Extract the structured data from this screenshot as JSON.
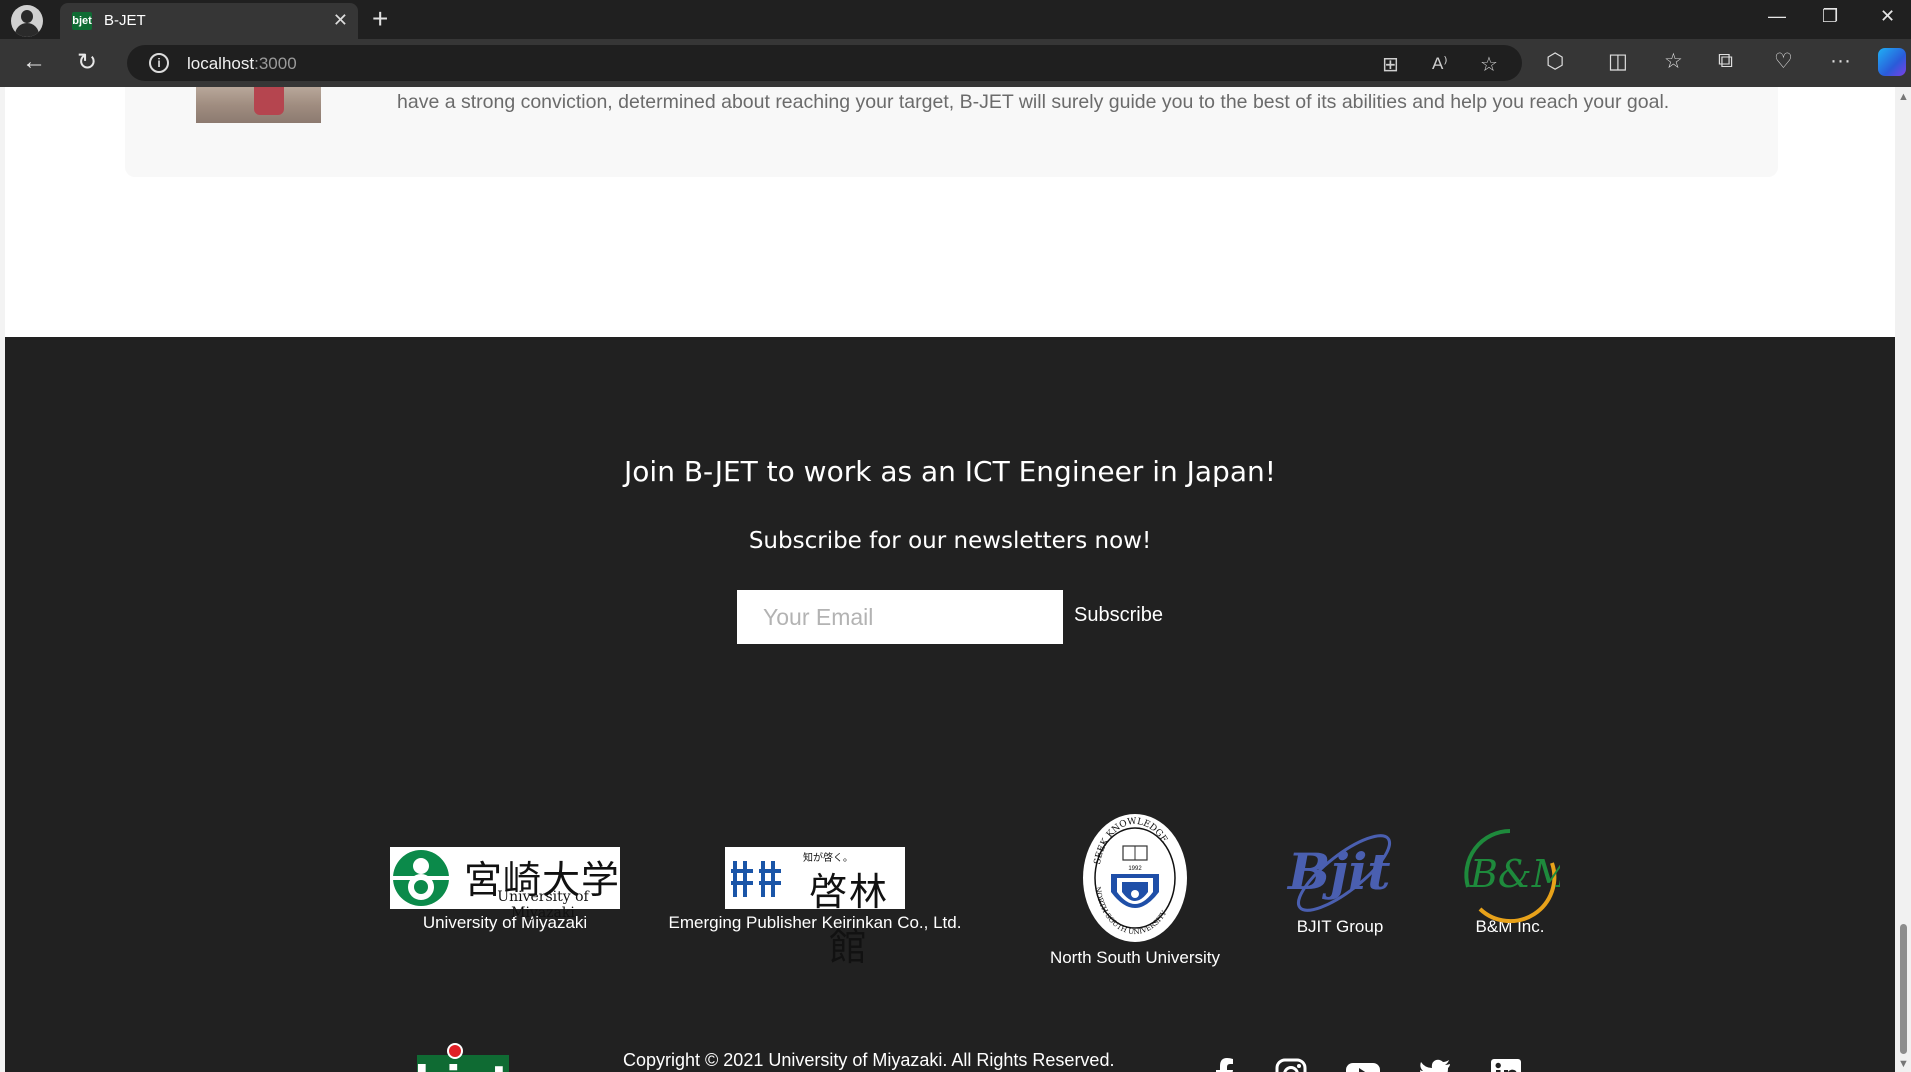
{
  "browser": {
    "tab_title": "B-JET",
    "tab_favicon_text": "bjet",
    "address_host": "localhost",
    "address_port": ":3000"
  },
  "page": {
    "card_text": "have a strong conviction, determined about reaching your target, B-JET will surely guide you to the best of its abilities and help you reach your goal.",
    "footer": {
      "heading": "Join B-JET to work as an ICT Engineer in Japan!",
      "subheading": "Subscribe for our newsletters now!",
      "email_placeholder": "Your Email",
      "subscribe_label": "Subscribe",
      "partners": [
        {
          "name": "University of Miyazaki",
          "logo_jp": "宮崎大学",
          "logo_en": "University of Miyazaki"
        },
        {
          "name": "Emerging Publisher Keirinkan Co., Ltd.",
          "logo_jp": "啓林館",
          "logo_tagline": "知が啓く。"
        },
        {
          "name": "North South University",
          "seal_top": "SEEK KNOWLEDGE",
          "seal_bottom": "NORTH SOUTH UNIVERSITY",
          "seal_year": "1992"
        },
        {
          "name": "BJIT Group",
          "logo_text": "Bjit"
        },
        {
          "name": "B&M Inc.",
          "logo_text": "B&M"
        }
      ],
      "brand_logo_text": "bjet",
      "copyright": "Copyright © 2021 University of Miyazaki. All Rights Reserved.",
      "social": [
        "facebook-icon",
        "instagram-icon",
        "youtube-icon",
        "twitter-icon",
        "linkedin-icon"
      ]
    }
  },
  "colors": {
    "footer_bg": "#212121",
    "brand_green": "#0f6b33",
    "bjit_blue": "#4a5fb0",
    "bm_green": "#1e8a3c",
    "bm_orange": "#e8a21a"
  }
}
